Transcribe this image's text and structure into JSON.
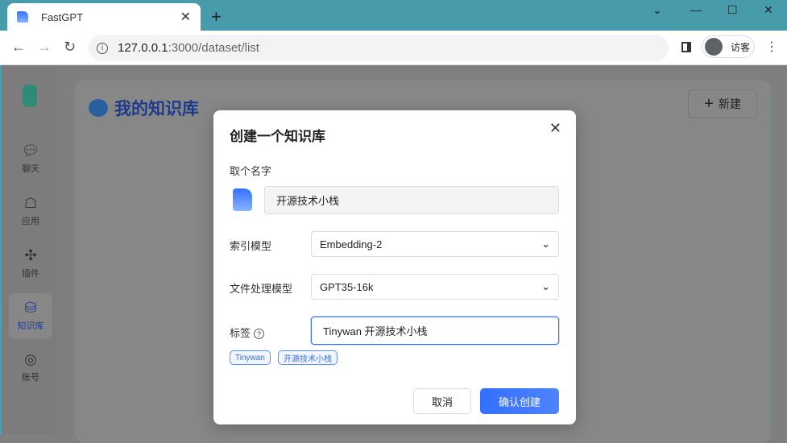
{
  "browser": {
    "tab_title": "FastGPT",
    "url_host": "127.0.0.1",
    "url_path": ":3000/dataset/list",
    "profile": "访客"
  },
  "sidebar": {
    "items": [
      {
        "label": "聊天",
        "icon": "chat-icon"
      },
      {
        "label": "应用",
        "icon": "robot-icon"
      },
      {
        "label": "插件",
        "icon": "puzzle-icon"
      },
      {
        "label": "知识库",
        "icon": "database-icon",
        "active": true
      },
      {
        "label": "账号",
        "icon": "user-icon"
      }
    ]
  },
  "page": {
    "title": "我的知识库",
    "new_button": "新建"
  },
  "modal": {
    "title": "创建一个知识库",
    "name_label": "取个名字",
    "name_value": "开源技术小栈",
    "index_model_label": "索引模型",
    "index_model_value": "Embedding-2",
    "file_model_label": "文件处理模型",
    "file_model_value": "GPT35-16k",
    "tags_label": "标签",
    "tags_value": "Tinywan 开源技术小栈",
    "tags": [
      "Tinywan",
      "开源技术小栈"
    ],
    "cancel": "取消",
    "confirm": "确认创建"
  }
}
